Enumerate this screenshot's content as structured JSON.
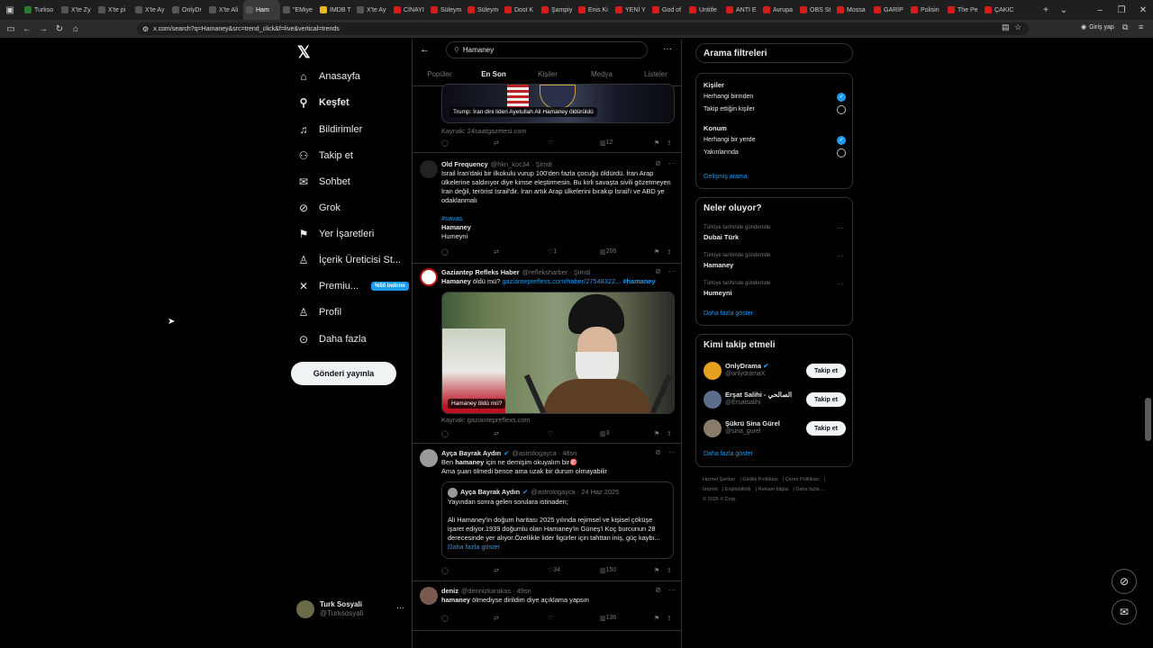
{
  "browser": {
    "tabs": [
      {
        "label": "Turkso",
        "fav": "#2a7a2a"
      },
      {
        "label": "X'te Zy",
        "fav": "#555"
      },
      {
        "label": "X'te pi",
        "fav": "#555"
      },
      {
        "label": "X'te Ay",
        "fav": "#555"
      },
      {
        "label": "OnlyDr",
        "fav": "#555"
      },
      {
        "label": "X'te Ali",
        "fav": "#555"
      },
      {
        "label": "Ham",
        "fav": "#555",
        "active": true
      },
      {
        "label": "\"EMiye",
        "fav": "#555"
      },
      {
        "label": "IMDB T",
        "fav": "#e6b91e"
      },
      {
        "label": "X'te Ay",
        "fav": "#555"
      },
      {
        "label": "CİNAYI",
        "fav": "#d41c1c"
      },
      {
        "label": "Süleym",
        "fav": "#d41c1c"
      },
      {
        "label": "Süleym",
        "fav": "#d41c1c"
      },
      {
        "label": "Dost K",
        "fav": "#d41c1c"
      },
      {
        "label": "Şampiy",
        "fav": "#d41c1c"
      },
      {
        "label": "Enis Ki",
        "fav": "#d41c1c"
      },
      {
        "label": "YENİ Y",
        "fav": "#d41c1c"
      },
      {
        "label": "God of",
        "fav": "#d41c1c"
      },
      {
        "label": "Untitle",
        "fav": "#d41c1c"
      },
      {
        "label": "ANTİ E",
        "fav": "#d41c1c"
      },
      {
        "label": "Avrupa",
        "fav": "#d41c1c"
      },
      {
        "label": "OBS St",
        "fav": "#d41c1c"
      },
      {
        "label": "Mossa",
        "fav": "#d41c1c"
      },
      {
        "label": "GARİP",
        "fav": "#d41c1c"
      },
      {
        "label": "Polisin",
        "fav": "#d41c1c"
      },
      {
        "label": "The Pe",
        "fav": "#d41c1c"
      },
      {
        "label": "ÇAKIC",
        "fav": "#d41c1c"
      }
    ],
    "url": "x.com/search?q=Hamaney&src=trend_click&f=live&vertical=trends",
    "login_label": "Giriş yap"
  },
  "nav": {
    "items": [
      {
        "label": "Anasayfa",
        "icon": "home-icon",
        "glyph": "⌂"
      },
      {
        "label": "Keşfet",
        "icon": "search-icon",
        "glyph": "⚲",
        "active": true
      },
      {
        "label": "Bildirimler",
        "icon": "bell-icon",
        "glyph": "♫"
      },
      {
        "label": "Takip et",
        "icon": "person-plus-icon",
        "glyph": "⚇"
      },
      {
        "label": "Sohbet",
        "icon": "mail-icon",
        "glyph": "✉"
      },
      {
        "label": "Grok",
        "icon": "grok-icon",
        "glyph": "⊘"
      },
      {
        "label": "Yer İşaretleri",
        "icon": "bookmark-icon",
        "glyph": "⚑"
      },
      {
        "label": "İçerik Üreticisi St...",
        "icon": "creator-icon",
        "glyph": "♙"
      },
      {
        "label": "Premiu...",
        "icon": "x-premium-icon",
        "glyph": "✕",
        "badge": "%50 indirim"
      },
      {
        "label": "Profil",
        "icon": "profile-icon",
        "glyph": "♙"
      },
      {
        "label": "Daha fazla",
        "icon": "more-circle-icon",
        "glyph": "⊙"
      }
    ],
    "post_button": "Gönderi yayınla",
    "account": {
      "name": "Turk Sosyali",
      "handle": "@Turksosyali"
    }
  },
  "search": {
    "query": "Hamaney"
  },
  "tabs": [
    "Popüler",
    "En Son",
    "Kişiler",
    "Medya",
    "Listeler"
  ],
  "tweets": {
    "t0": {
      "image_caption": "Trump: İran dini lideri Ayetullah Ali Hamaney öldürüldü",
      "source": "Kaynak: 24saatgazetesi.com",
      "views": "12"
    },
    "t1": {
      "name": "Old Frequency",
      "handle": "@hkn_koc34 · Şimdi",
      "text": "İsrail İran'daki bir ilkokulu vurup 100'den fazla çocuğu öldürdü. İran Arap ülkelerine saldırıyor diye kimse eleştirmesin. Bu kirli savaşta sivili gözetmeyen İran değil, terörist İsrail'dir. İran artık Arap ülkelerini bırakıp İsrail'i ve ABD ye odaklanmalı",
      "hashtag": "#savas",
      "line2": "Hamaney",
      "line3": "Humeyni",
      "likes": "1",
      "views": "206"
    },
    "t2": {
      "name": "Gaziantep Refleks Haber",
      "handle": "@refleksharber · Şimdi",
      "text_bold": "Hamaney",
      "text": " öldü mü? ",
      "link": "gaziantepreflexs.com/haber/27548322...",
      "hashtag": " #hamaney",
      "image_caption": "Hamaney öldü mü?",
      "source": "Kaynak: gaziantepreflexs.com",
      "views": "3"
    },
    "t3": {
      "name": "Ayça Bayrak Aydın",
      "handle": "@astrologayca · 48sn",
      "line1_pre": "Ben ",
      "line1_bold": "hamaney",
      "line1_post": " için ne demişim okuyalım bir🎯",
      "line2": "Ama şuan ölmedi bence ama uzak bir durum olmayabilir",
      "quote": {
        "name": "Ayça Bayrak Aydın",
        "handle": "@astrologayca · 24 Haz 2025",
        "line1": "Yayından sonra gelen sorulara istinaden;",
        "body": "Ali Hamaney'in doğum haritası 2025 yılında rejimsel ve kişisel çöküşe işaret ediyor.1939 doğumlu olan Hamaney'in Güneş'i Koç burcunun 28 derecesinde yer alıyor.Özellikle lider figürler için tahttan iniş, güç kaybı...",
        "more": "Daha fazla göster"
      },
      "likes": "34",
      "views": "150"
    },
    "t4": {
      "name": "deniz",
      "handle": "@dennizkarakas · 49sn",
      "text_bold": "hamaney",
      "text": " ölmediyse dirildim diye açıklama yapsın",
      "views": "136"
    }
  },
  "filters": {
    "title": "Arama filtreleri",
    "people_label": "Kişiler",
    "people_opt1": "Herhangi birinden",
    "people_opt2": "Takip ettiğin kişiler",
    "location_label": "Konum",
    "loc_opt1": "Herhangi bir yerde",
    "loc_opt2": "Yakınlarında",
    "advanced": "Gelişmiş arama"
  },
  "trends": {
    "title": "Neler oluyor?",
    "items": [
      {
        "sub": "Türkiye tarihinde gündemde",
        "name": "Dubai Türk"
      },
      {
        "sub": "Türkiye tarihinde gündemde",
        "name": "Hamaney"
      },
      {
        "sub": "Türkiye tarihinde gündemde",
        "name": "Humeyni"
      }
    ],
    "show_more": "Daha fazla göster"
  },
  "who_to_follow": {
    "title": "Kimi takip etmeli",
    "items": [
      {
        "name": "OnlyDrama",
        "handle": "@onlydramaX",
        "color": "#e6a21e",
        "btn": "Takip et"
      },
      {
        "name": "Erşat Salihi - الصالحي",
        "handle": "@Ersatsalihi",
        "color": "#5a6e8a",
        "btn": "Takip et"
      },
      {
        "name": "Şükrü Sina Gürel",
        "handle": "@sina_gurel",
        "color": "#8a7a6a",
        "btn": "Takip et"
      }
    ],
    "show_more": "Daha fazla göster"
  },
  "footer": [
    "Hizmet Şartları",
    "Gizlilik Politikası",
    "Çerez Politikası",
    "İmprint",
    "Erişilebilirlik",
    "Reklam bilgisi",
    "Daha fazla ...",
    "© 2026 X Corp."
  ],
  "colors": {
    "accent": "#1d9bf0",
    "background": "#000000",
    "border": "#2f3336"
  }
}
